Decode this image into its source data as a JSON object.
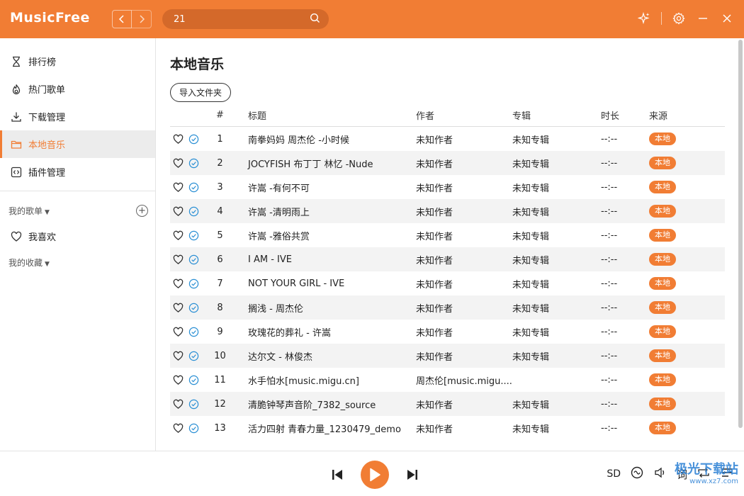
{
  "app": {
    "name": "MusicFree"
  },
  "search": {
    "value": "21"
  },
  "sidebar": {
    "items": [
      {
        "label": "排行榜",
        "icon": "hourglass-icon"
      },
      {
        "label": "热门歌单",
        "icon": "flame-icon"
      },
      {
        "label": "下载管理",
        "icon": "download-icon"
      },
      {
        "label": "本地音乐",
        "icon": "folder-icon",
        "active": true
      },
      {
        "label": "插件管理",
        "icon": "plugin-icon"
      }
    ],
    "my_playlists": "我的歌单",
    "favorites": "我喜欢",
    "my_collection": "我的收藏"
  },
  "main": {
    "title": "本地音乐",
    "import_button": "导入文件夹",
    "columns": {
      "num": "#",
      "title": "标题",
      "artist": "作者",
      "album": "专辑",
      "duration": "时长",
      "source": "来源"
    },
    "rows": [
      {
        "num": "1",
        "title": "南拳妈妈 周杰伦 -小时候",
        "artist": "未知作者",
        "album": "未知专辑",
        "duration": "--:--",
        "source": "本地"
      },
      {
        "num": "2",
        "title": "JOCYFISH 布丁丁 林忆 -Nude",
        "artist": "未知作者",
        "album": "未知专辑",
        "duration": "--:--",
        "source": "本地"
      },
      {
        "num": "3",
        "title": "许嵩 -有何不可",
        "artist": "未知作者",
        "album": "未知专辑",
        "duration": "--:--",
        "source": "本地"
      },
      {
        "num": "4",
        "title": "许嵩 -清明雨上",
        "artist": "未知作者",
        "album": "未知专辑",
        "duration": "--:--",
        "source": "本地"
      },
      {
        "num": "5",
        "title": "许嵩 -雅俗共赏",
        "artist": "未知作者",
        "album": "未知专辑",
        "duration": "--:--",
        "source": "本地"
      },
      {
        "num": "6",
        "title": "I AM - IVE",
        "artist": "未知作者",
        "album": "未知专辑",
        "duration": "--:--",
        "source": "本地"
      },
      {
        "num": "7",
        "title": "NOT YOUR GIRL - IVE",
        "artist": "未知作者",
        "album": "未知专辑",
        "duration": "--:--",
        "source": "本地"
      },
      {
        "num": "8",
        "title": "搁浅 - 周杰伦",
        "artist": "未知作者",
        "album": "未知专辑",
        "duration": "--:--",
        "source": "本地"
      },
      {
        "num": "9",
        "title": "玫瑰花的葬礼 - 许嵩",
        "artist": "未知作者",
        "album": "未知专辑",
        "duration": "--:--",
        "source": "本地"
      },
      {
        "num": "10",
        "title": "达尔文 - 林俊杰",
        "artist": "未知作者",
        "album": "未知专辑",
        "duration": "--:--",
        "source": "本地"
      },
      {
        "num": "11",
        "title": "水手怕水[music.migu.cn]",
        "artist": "周杰伦[music.migu....",
        "album": "",
        "duration": "--:--",
        "source": "本地"
      },
      {
        "num": "12",
        "title": "清脆钟琴声音阶_7382_source",
        "artist": "未知作者",
        "album": "未知专辑",
        "duration": "--:--",
        "source": "本地"
      },
      {
        "num": "13",
        "title": "活力四射 青春力量_1230479_demo",
        "artist": "未知作者",
        "album": "未知专辑",
        "duration": "--:--",
        "source": "本地"
      }
    ]
  },
  "player": {
    "quality": "SD",
    "lyric": "词"
  },
  "watermark": {
    "text": "极光下载站",
    "url": "www.xz7.com"
  },
  "colors": {
    "accent": "#f17d34",
    "check": "#2a8fd4"
  }
}
